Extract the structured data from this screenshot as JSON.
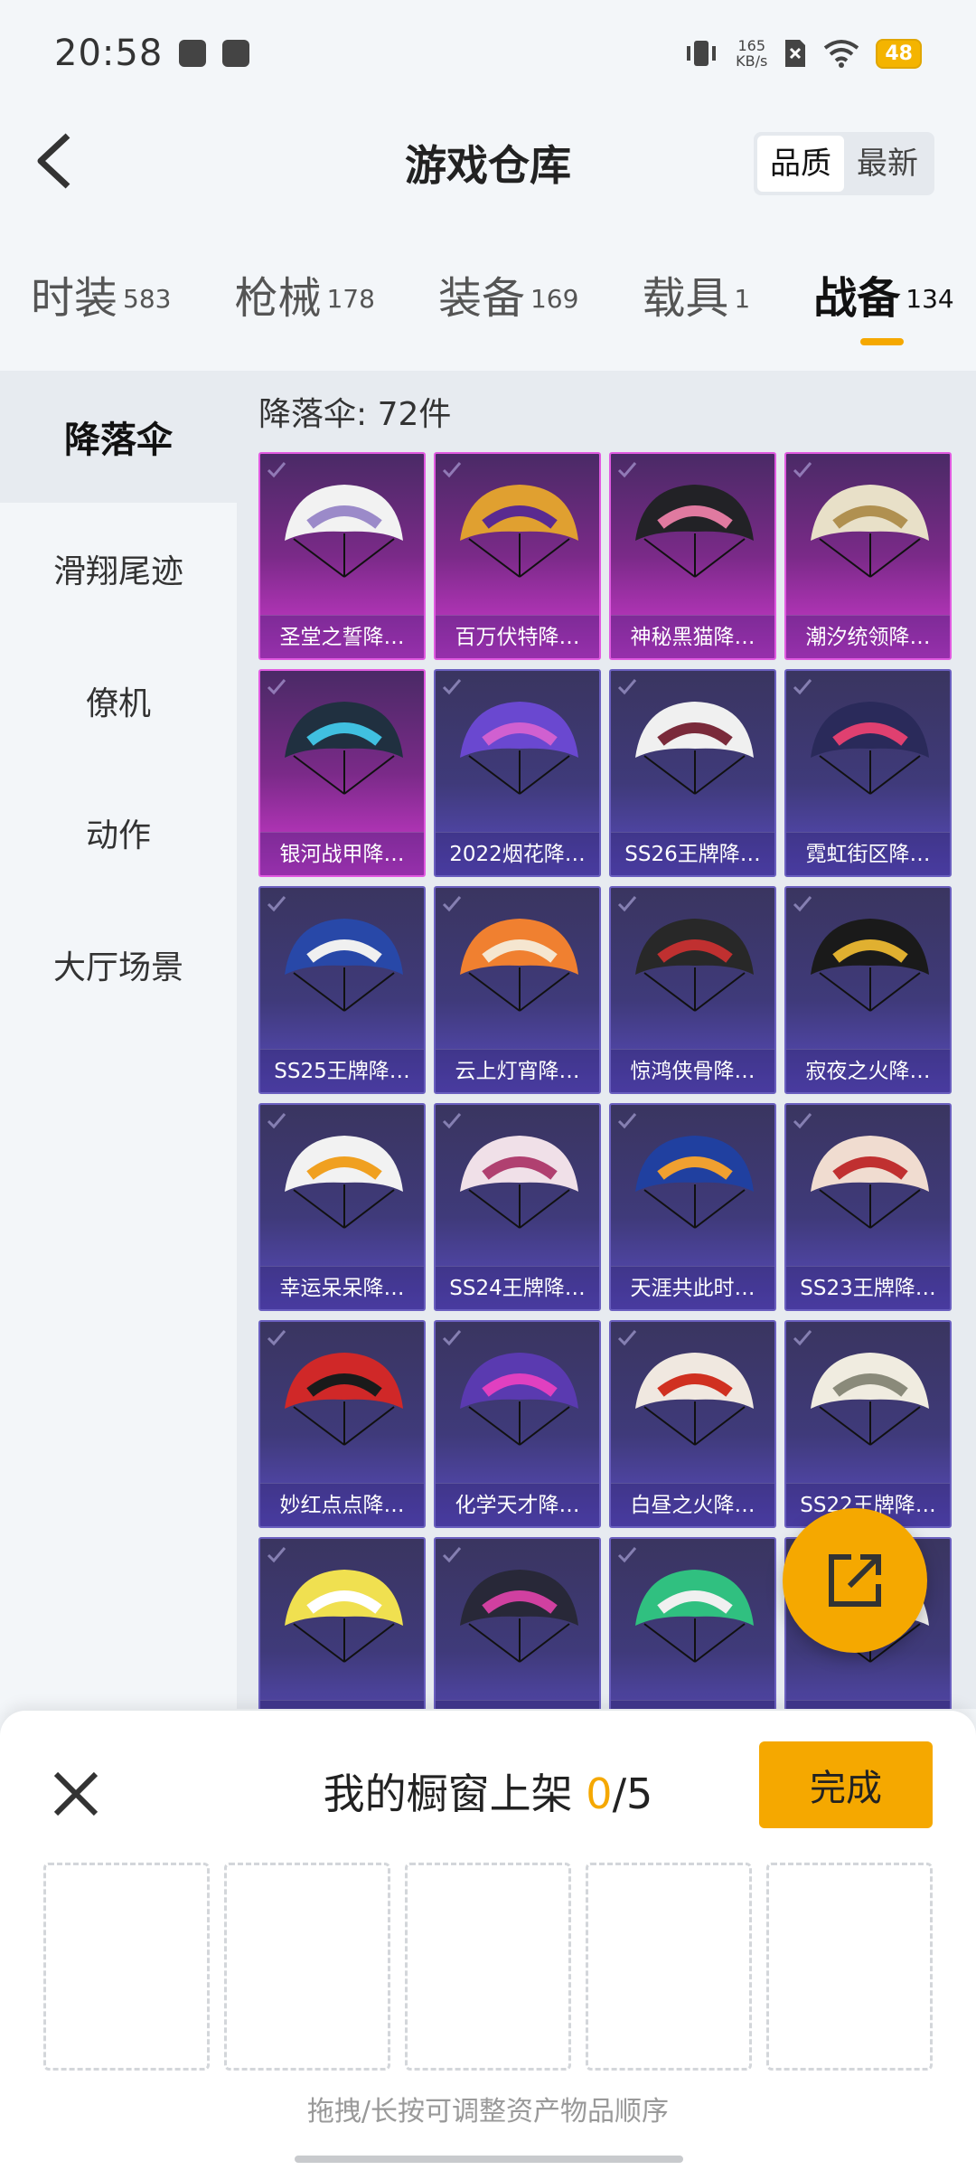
{
  "status_bar": {
    "time": "20:58",
    "net_speed_value": "165",
    "net_speed_unit": "KB/s",
    "battery": "48"
  },
  "header": {
    "title": "游戏仓库",
    "sort_options": [
      "品质",
      "最新"
    ],
    "sort_selected": "品质"
  },
  "category_tabs": [
    {
      "label": "时装",
      "count": "583",
      "active": false
    },
    {
      "label": "枪械",
      "count": "178",
      "active": false
    },
    {
      "label": "装备",
      "count": "169",
      "active": false
    },
    {
      "label": "载具",
      "count": "1",
      "active": false
    },
    {
      "label": "战备",
      "count": "134",
      "active": true
    }
  ],
  "side_nav": [
    {
      "label": "降落伞",
      "active": true
    },
    {
      "label": "滑翔尾迹",
      "active": false
    },
    {
      "label": "僚机",
      "active": false
    },
    {
      "label": "动作",
      "active": false
    },
    {
      "label": "大厅场景",
      "active": false
    }
  ],
  "content": {
    "count_line": "降落伞: 72件",
    "items": [
      {
        "name": "圣堂之誓降…",
        "rarity": "purple",
        "c1": "#f2f2f2",
        "c2": "#9b8ac9"
      },
      {
        "name": "百万伏特降…",
        "rarity": "purple",
        "c1": "#e0a030",
        "c2": "#5a2a90"
      },
      {
        "name": "神秘黑猫降…",
        "rarity": "purple",
        "c1": "#222226",
        "c2": "#e07aa0"
      },
      {
        "name": "潮汐统领降…",
        "rarity": "purple",
        "c1": "#e8e0c8",
        "c2": "#b09050"
      },
      {
        "name": "银河战甲降…",
        "rarity": "purple",
        "c1": "#203040",
        "c2": "#40c0e0"
      },
      {
        "name": "2022烟花降…",
        "rarity": "blue",
        "c1": "#6a48d0",
        "c2": "#d060d0"
      },
      {
        "name": "SS26王牌降…",
        "rarity": "blue",
        "c1": "#f0f0f0",
        "c2": "#7a2a3a"
      },
      {
        "name": "霓虹街区降…",
        "rarity": "blue",
        "c1": "#2a2a5a",
        "c2": "#e04070"
      },
      {
        "name": "SS25王牌降…",
        "rarity": "blue",
        "c1": "#2848a8",
        "c2": "#f0f0f0"
      },
      {
        "name": "云上灯宵降…",
        "rarity": "blue",
        "c1": "#f08030",
        "c2": "#f5e6d0"
      },
      {
        "name": "惊鸿侠骨降…",
        "rarity": "blue",
        "c1": "#282828",
        "c2": "#c03030"
      },
      {
        "name": "寂夜之火降…",
        "rarity": "blue",
        "c1": "#1a1a1a",
        "c2": "#e0b030"
      },
      {
        "name": "幸运呆呆降…",
        "rarity": "blue",
        "c1": "#f2f2f2",
        "c2": "#f0a020"
      },
      {
        "name": "SS24王牌降…",
        "rarity": "blue",
        "c1": "#f0e0e8",
        "c2": "#b04070"
      },
      {
        "name": "天涯共此时…",
        "rarity": "blue",
        "c1": "#2040a0",
        "c2": "#f0a030"
      },
      {
        "name": "SS23王牌降…",
        "rarity": "blue",
        "c1": "#f0dcd0",
        "c2": "#c03030"
      },
      {
        "name": "妙红点点降…",
        "rarity": "blue",
        "c1": "#d02828",
        "c2": "#1a1a1a"
      },
      {
        "name": "化学天才降…",
        "rarity": "blue",
        "c1": "#5a3ab0",
        "c2": "#e040c0"
      },
      {
        "name": "白昼之火降…",
        "rarity": "blue",
        "c1": "#f0e8e0",
        "c2": "#d03020"
      },
      {
        "name": "SS22王牌降…",
        "rarity": "blue",
        "c1": "#f0ece0",
        "c2": "#8a8a7a"
      },
      {
        "name": "",
        "rarity": "blue",
        "c1": "#f0e050",
        "c2": "#ffffff"
      },
      {
        "name": "",
        "rarity": "blue",
        "c1": "#282838",
        "c2": "#d040a0"
      },
      {
        "name": "",
        "rarity": "blue",
        "c1": "#30c080",
        "c2": "#f0f0f0"
      },
      {
        "name": "",
        "rarity": "blue",
        "c1": "#f0f0f0",
        "c2": "#c0c0c0"
      }
    ]
  },
  "showcase_panel": {
    "title": "我的橱窗上架 ",
    "current": "0",
    "total": "/5",
    "done_label": "完成",
    "slot_count": 5,
    "hint": "拖拽/长按可调整资产物品顺序"
  },
  "colors": {
    "accent": "#f5a800",
    "legend_border": "#e05ae0",
    "epic_border": "#6a5fbf"
  }
}
